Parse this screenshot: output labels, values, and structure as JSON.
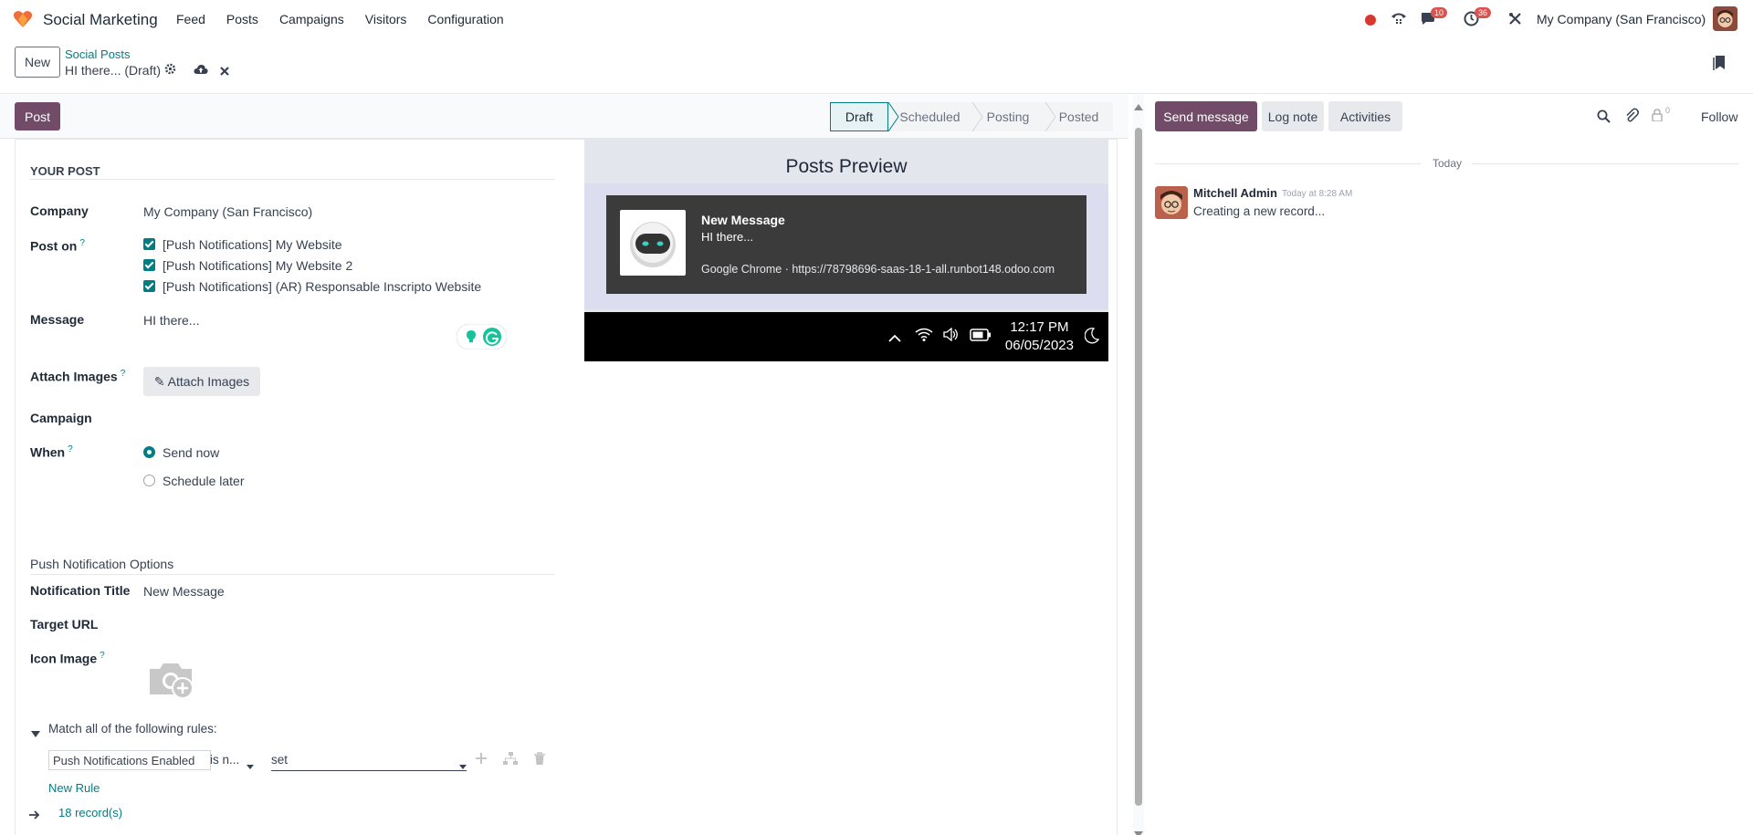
{
  "navbar": {
    "app_name": "Social Marketing",
    "menu": [
      "Feed",
      "Posts",
      "Campaigns",
      "Visitors",
      "Configuration"
    ],
    "messages_badge": "10",
    "activities_badge": "36",
    "company": "My Company (San Francisco)"
  },
  "control_panel": {
    "new_label": "New",
    "breadcrumb_parent": "Social Posts",
    "breadcrumb_current": "HI there... (Draft)"
  },
  "statusbar": {
    "post_label": "Post",
    "stages": [
      "Draft",
      "Scheduled",
      "Posting",
      "Posted"
    ],
    "active_stage": "Draft"
  },
  "form": {
    "section_title": "YOUR POST",
    "company_label": "Company",
    "company_value": "My Company (San Francisco)",
    "post_on_label": "Post on",
    "help_mark": "?",
    "post_on_options": [
      "[Push Notifications] My Website",
      "[Push Notifications] My Website 2",
      "[Push Notifications] (AR) Responsable Inscripto Website"
    ],
    "message_label": "Message",
    "message_value": "HI there...",
    "attach_label": "Attach Images",
    "attach_button": "Attach Images",
    "campaign_label": "Campaign",
    "when_label": "When",
    "when_options": [
      "Send now",
      "Schedule later"
    ],
    "when_selected": "Send now",
    "push_section": "Push Notification Options",
    "notif_title_label": "Notification Title",
    "notif_title_value": "New Message",
    "target_url_label": "Target URL",
    "icon_image_label": "Icon Image",
    "rules_header": "Match all of the following rules:",
    "rule_field": "Push Notifications Enabled",
    "rule_operator": "is n...",
    "rule_value": "set",
    "new_rule": "New Rule",
    "records": "18 record(s)"
  },
  "preview": {
    "title": "Posts Preview",
    "notif_title": "New Message",
    "notif_message": "HI there...",
    "notif_source": "Google Chrome · https://78798696-saas-18-1-all.runbot148.odoo.com",
    "time": "12:17 PM",
    "date": "06/05/2023"
  },
  "chatter": {
    "send_message": "Send message",
    "log_note": "Log note",
    "activities": "Activities",
    "followers_count": "0",
    "follow": "Follow",
    "today": "Today",
    "author": "Mitchell Admin",
    "date": "Today at 8:28 AM",
    "body": "Creating a new record..."
  },
  "colors": {
    "primary": "#714b67",
    "accent": "#017e84",
    "badge": "#d9534f"
  }
}
